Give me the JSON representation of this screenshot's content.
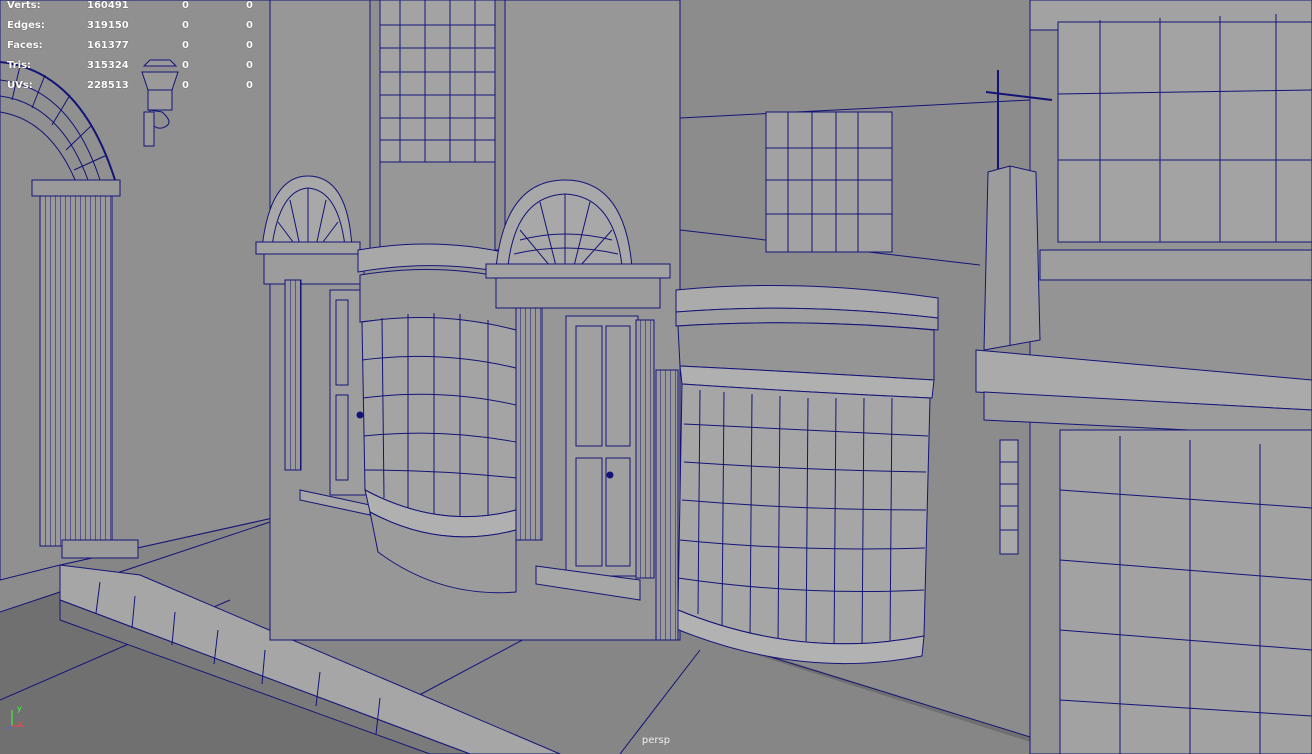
{
  "viewport": {
    "camera": "persp",
    "background_color": "#8c8c8c",
    "wireframe_color": "#141478"
  },
  "heads_up": {
    "rows": [
      {
        "label": "Verts:",
        "total": "160491",
        "selected": "0",
        "selected_components": "0"
      },
      {
        "label": "Edges:",
        "total": "319150",
        "selected": "0",
        "selected_components": "0"
      },
      {
        "label": "Faces:",
        "total": "161377",
        "selected": "0",
        "selected_components": "0"
      },
      {
        "label": "Tris:",
        "total": "315324",
        "selected": "0",
        "selected_components": "0"
      },
      {
        "label": "UVs:",
        "total": "228513",
        "selected": "0",
        "selected_components": "0"
      }
    ]
  },
  "axis_indicator": {
    "y_label": "y",
    "x_label": "x"
  }
}
